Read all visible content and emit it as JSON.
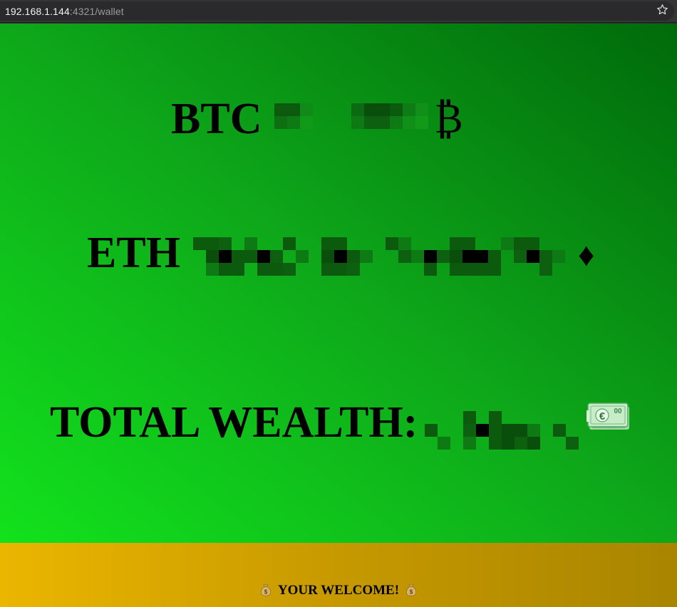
{
  "browser": {
    "url_host": "192.168.1.144",
    "url_rest": ":4321/wallet",
    "bookmark_icon": "star-icon"
  },
  "wallet": {
    "btc": {
      "label": "BTC",
      "symbol": "₿"
    },
    "eth": {
      "label": "ETH",
      "symbol": "♦"
    },
    "total": {
      "label": "TOTAL WEALTH:",
      "icon": "euro-banknote-icon"
    }
  },
  "footer": {
    "text": "YOUR WELCOME!",
    "icon": "money-bag-icon"
  },
  "colors": {
    "main_gradient": [
      "#12e21c",
      "#0ea81a",
      "#006a0a"
    ],
    "footer_gradient": [
      "#ebb600",
      "#c69900",
      "#a98500"
    ]
  }
}
